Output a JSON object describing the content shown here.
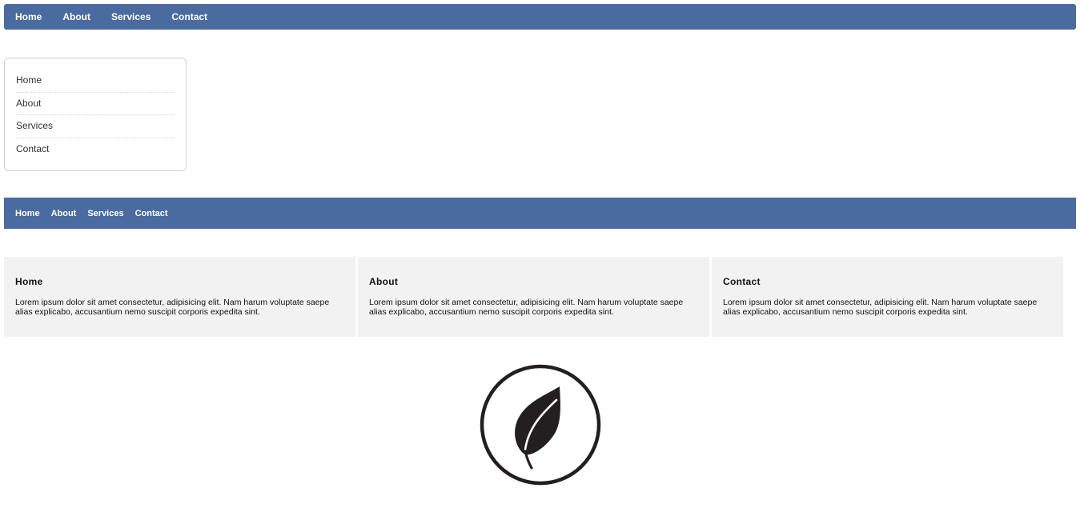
{
  "top_nav": {
    "items": [
      {
        "label": "Home"
      },
      {
        "label": "About"
      },
      {
        "label": "Services"
      },
      {
        "label": "Contact"
      }
    ]
  },
  "side_menu": {
    "items": [
      {
        "label": "Home"
      },
      {
        "label": "About"
      },
      {
        "label": "Services"
      },
      {
        "label": "Contact"
      }
    ]
  },
  "second_nav": {
    "items": [
      {
        "label": "Home"
      },
      {
        "label": "About"
      },
      {
        "label": "Services"
      },
      {
        "label": "Contact"
      }
    ]
  },
  "cards": [
    {
      "title": "Home",
      "text": "Lorem ipsum dolor sit amet consectetur, adipisicing elit. Nam harum voluptate saepe alias explicabo, accusantium nemo suscipit corporis expedita sint."
    },
    {
      "title": "About",
      "text": "Lorem ipsum dolor sit amet consectetur, adipisicing elit. Nam harum voluptate saepe alias explicabo, accusantium nemo suscipit corporis expedita sint."
    },
    {
      "title": "Contact",
      "text": "Lorem ipsum dolor sit amet consectetur, adipisicing elit. Nam harum voluptate saepe alias explicabo, accusantium nemo suscipit corporis expedita sint."
    }
  ],
  "logo": {
    "icon": "leaf-icon"
  },
  "colors": {
    "nav_background": "#4a6ba0",
    "card_background": "#f2f2f2"
  }
}
